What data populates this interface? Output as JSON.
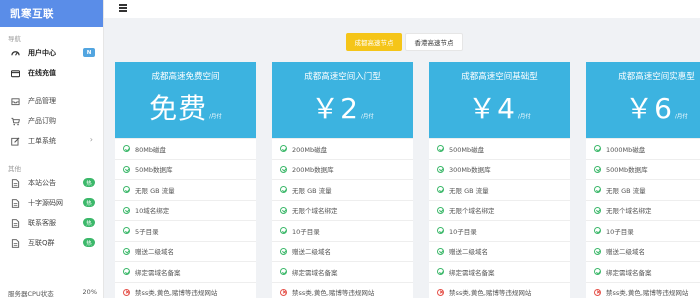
{
  "brand": "凯寒互联",
  "sidebar": {
    "section_nav": "导航",
    "items": [
      {
        "label": "用户中心",
        "icon": "dashboard-icon",
        "badge": "N",
        "badge_color": "blue"
      },
      {
        "label": "在线充值",
        "icon": "card-icon",
        "badge": "",
        "badge_color": ""
      },
      {
        "label": "产品管理",
        "icon": "inbox-icon",
        "badge": "",
        "badge_color": ""
      },
      {
        "label": "产品订购",
        "icon": "cart-icon",
        "badge": "",
        "badge_color": ""
      },
      {
        "label": "工单系统",
        "icon": "edit-icon",
        "badge": "",
        "badge_color": "",
        "chevron": "›"
      }
    ],
    "section_other": "其他",
    "other_items": [
      {
        "label": "本站公告",
        "icon": "doc-icon",
        "badge": "热",
        "badge_color": "green"
      },
      {
        "label": "十字源码网",
        "icon": "doc-icon",
        "badge": "热",
        "badge_color": "green"
      },
      {
        "label": "联系客服",
        "icon": "doc-icon",
        "badge": "热",
        "badge_color": "green"
      },
      {
        "label": "互联Q群",
        "icon": "doc-icon",
        "badge": "热",
        "badge_color": "green"
      }
    ],
    "cpu_label": "服务器CPU状态",
    "cpu_value": "20%"
  },
  "tabs": [
    "成都高速节点",
    "香港高速节点"
  ],
  "active_tab": 0,
  "colors": {
    "brand_bar": "#5a8de8",
    "card_header": "#3cb3e0",
    "tab_active": "#f5c518",
    "check": "#3cb86a",
    "cross": "#e5534b"
  },
  "plans": [
    {
      "title": "成都高速免费空间",
      "price": "免费",
      "unit": "/月付",
      "features": [
        "80Mb磁盘",
        "50Mb数据库",
        "无限 GB 流量",
        "10域名绑定",
        "5子目录",
        "赠送二级域名",
        "绑定需域名备案",
        "禁ss类,黄色,赌博等违规网站"
      ]
    },
    {
      "title": "成都高速空间入门型",
      "price": "￥2",
      "unit": "/月付",
      "features": [
        "200Mb磁盘",
        "200Mb数据库",
        "无限 GB 流量",
        "无限个域名绑定",
        "10子目录",
        "赠送二级域名",
        "绑定需域名备案",
        "禁ss类,黄色,赌博等违规网站"
      ]
    },
    {
      "title": "成都高速空间基础型",
      "price": "￥4",
      "unit": "/月付",
      "features": [
        "500Mb磁盘",
        "300Mb数据库",
        "无限 GB 流量",
        "无限个域名绑定",
        "10子目录",
        "赠送二级域名",
        "绑定需域名备案",
        "禁ss类,黄色,赌博等违规网站"
      ]
    },
    {
      "title": "成都高速空间实惠型",
      "price": "￥6",
      "unit": "/月付",
      "features": [
        "1000Mb磁盘",
        "500Mb数据库",
        "无限 GB 流量",
        "无限个域名绑定",
        "10子目录",
        "赠送二级域名",
        "绑定需域名备案",
        "禁ss类,黄色,赌博等违规网站"
      ]
    }
  ]
}
